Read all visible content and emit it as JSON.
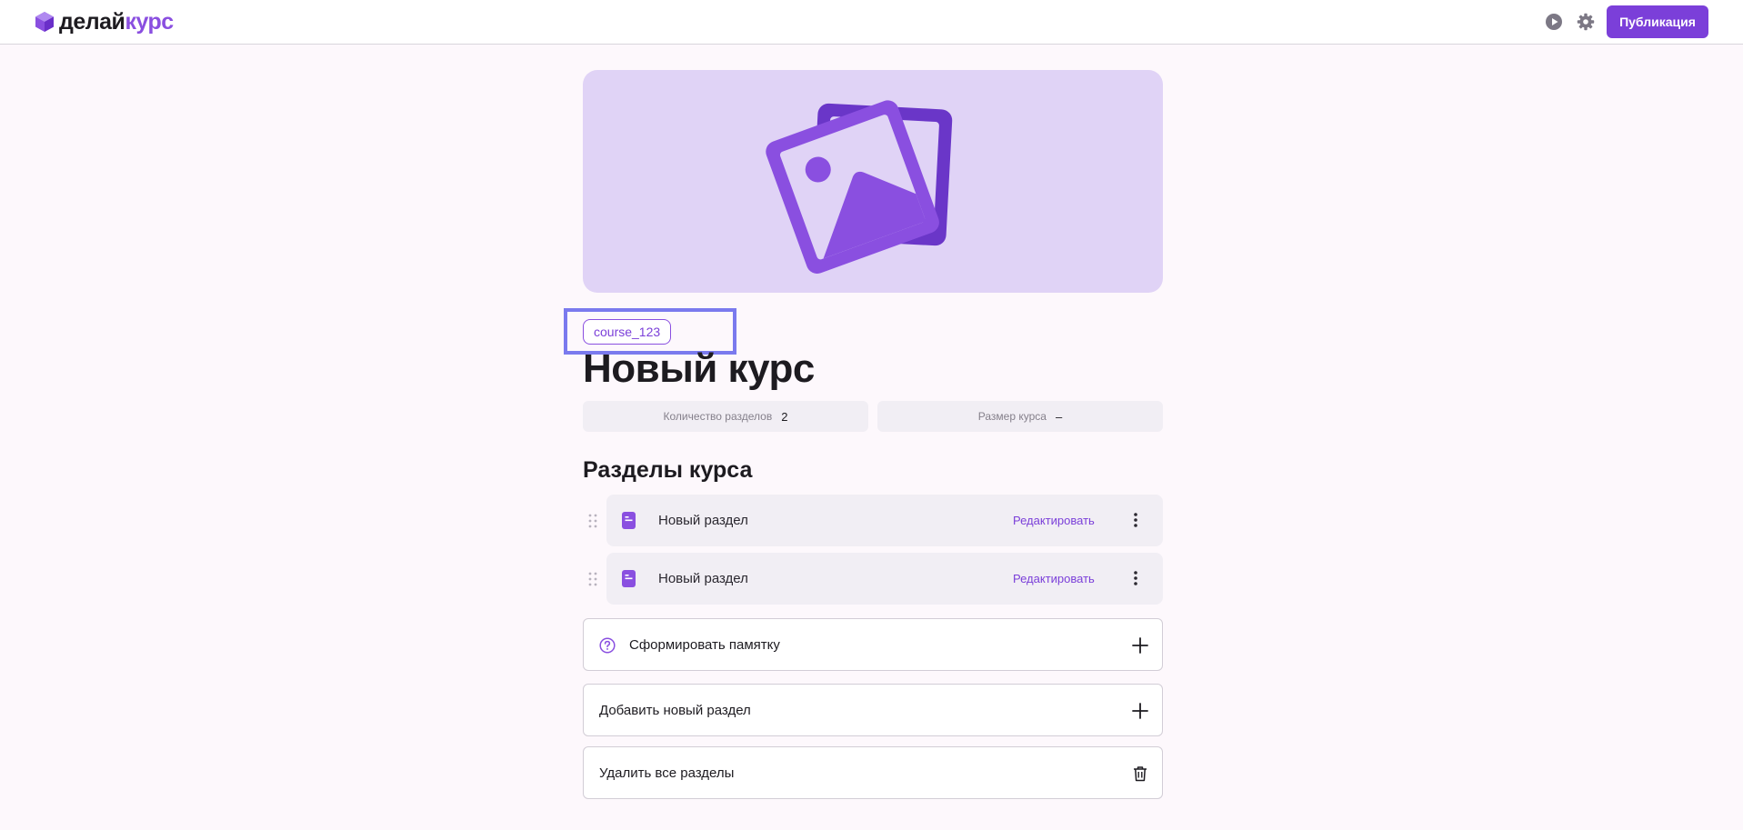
{
  "colors": {
    "accent": "#7b3fd9",
    "cover_bg": "#e0d3f6",
    "page_bg": "#fdf8fc"
  },
  "header": {
    "logo_part1": "делай",
    "logo_part2": "курс",
    "preview_icon": "play-circle-icon",
    "settings_icon": "gear-icon",
    "publish_label": "Публикация"
  },
  "cover": {
    "icon": "image-placeholder-icon"
  },
  "course": {
    "id_tag": "course_123",
    "title": "Новый курс"
  },
  "stats": [
    {
      "label": "Количество разделов",
      "value": "2"
    },
    {
      "label": "Размер курса",
      "value": "–"
    }
  ],
  "sections": {
    "heading": "Разделы курса",
    "items": [
      {
        "label": "Новый раздел",
        "edit_label": "Редактировать",
        "icon": "document-icon"
      },
      {
        "label": "Новый раздел",
        "edit_label": "Редактировать",
        "icon": "document-icon"
      }
    ]
  },
  "actions": {
    "memo": {
      "label": "Сформировать памятку",
      "icon_left": "help-circle-icon",
      "icon_right": "plus-icon"
    },
    "add_section": {
      "label": "Добавить новый раздел",
      "icon_right": "plus-icon"
    },
    "delete_all": {
      "label": "Удалить все разделы",
      "icon_right": "trash-icon"
    }
  }
}
